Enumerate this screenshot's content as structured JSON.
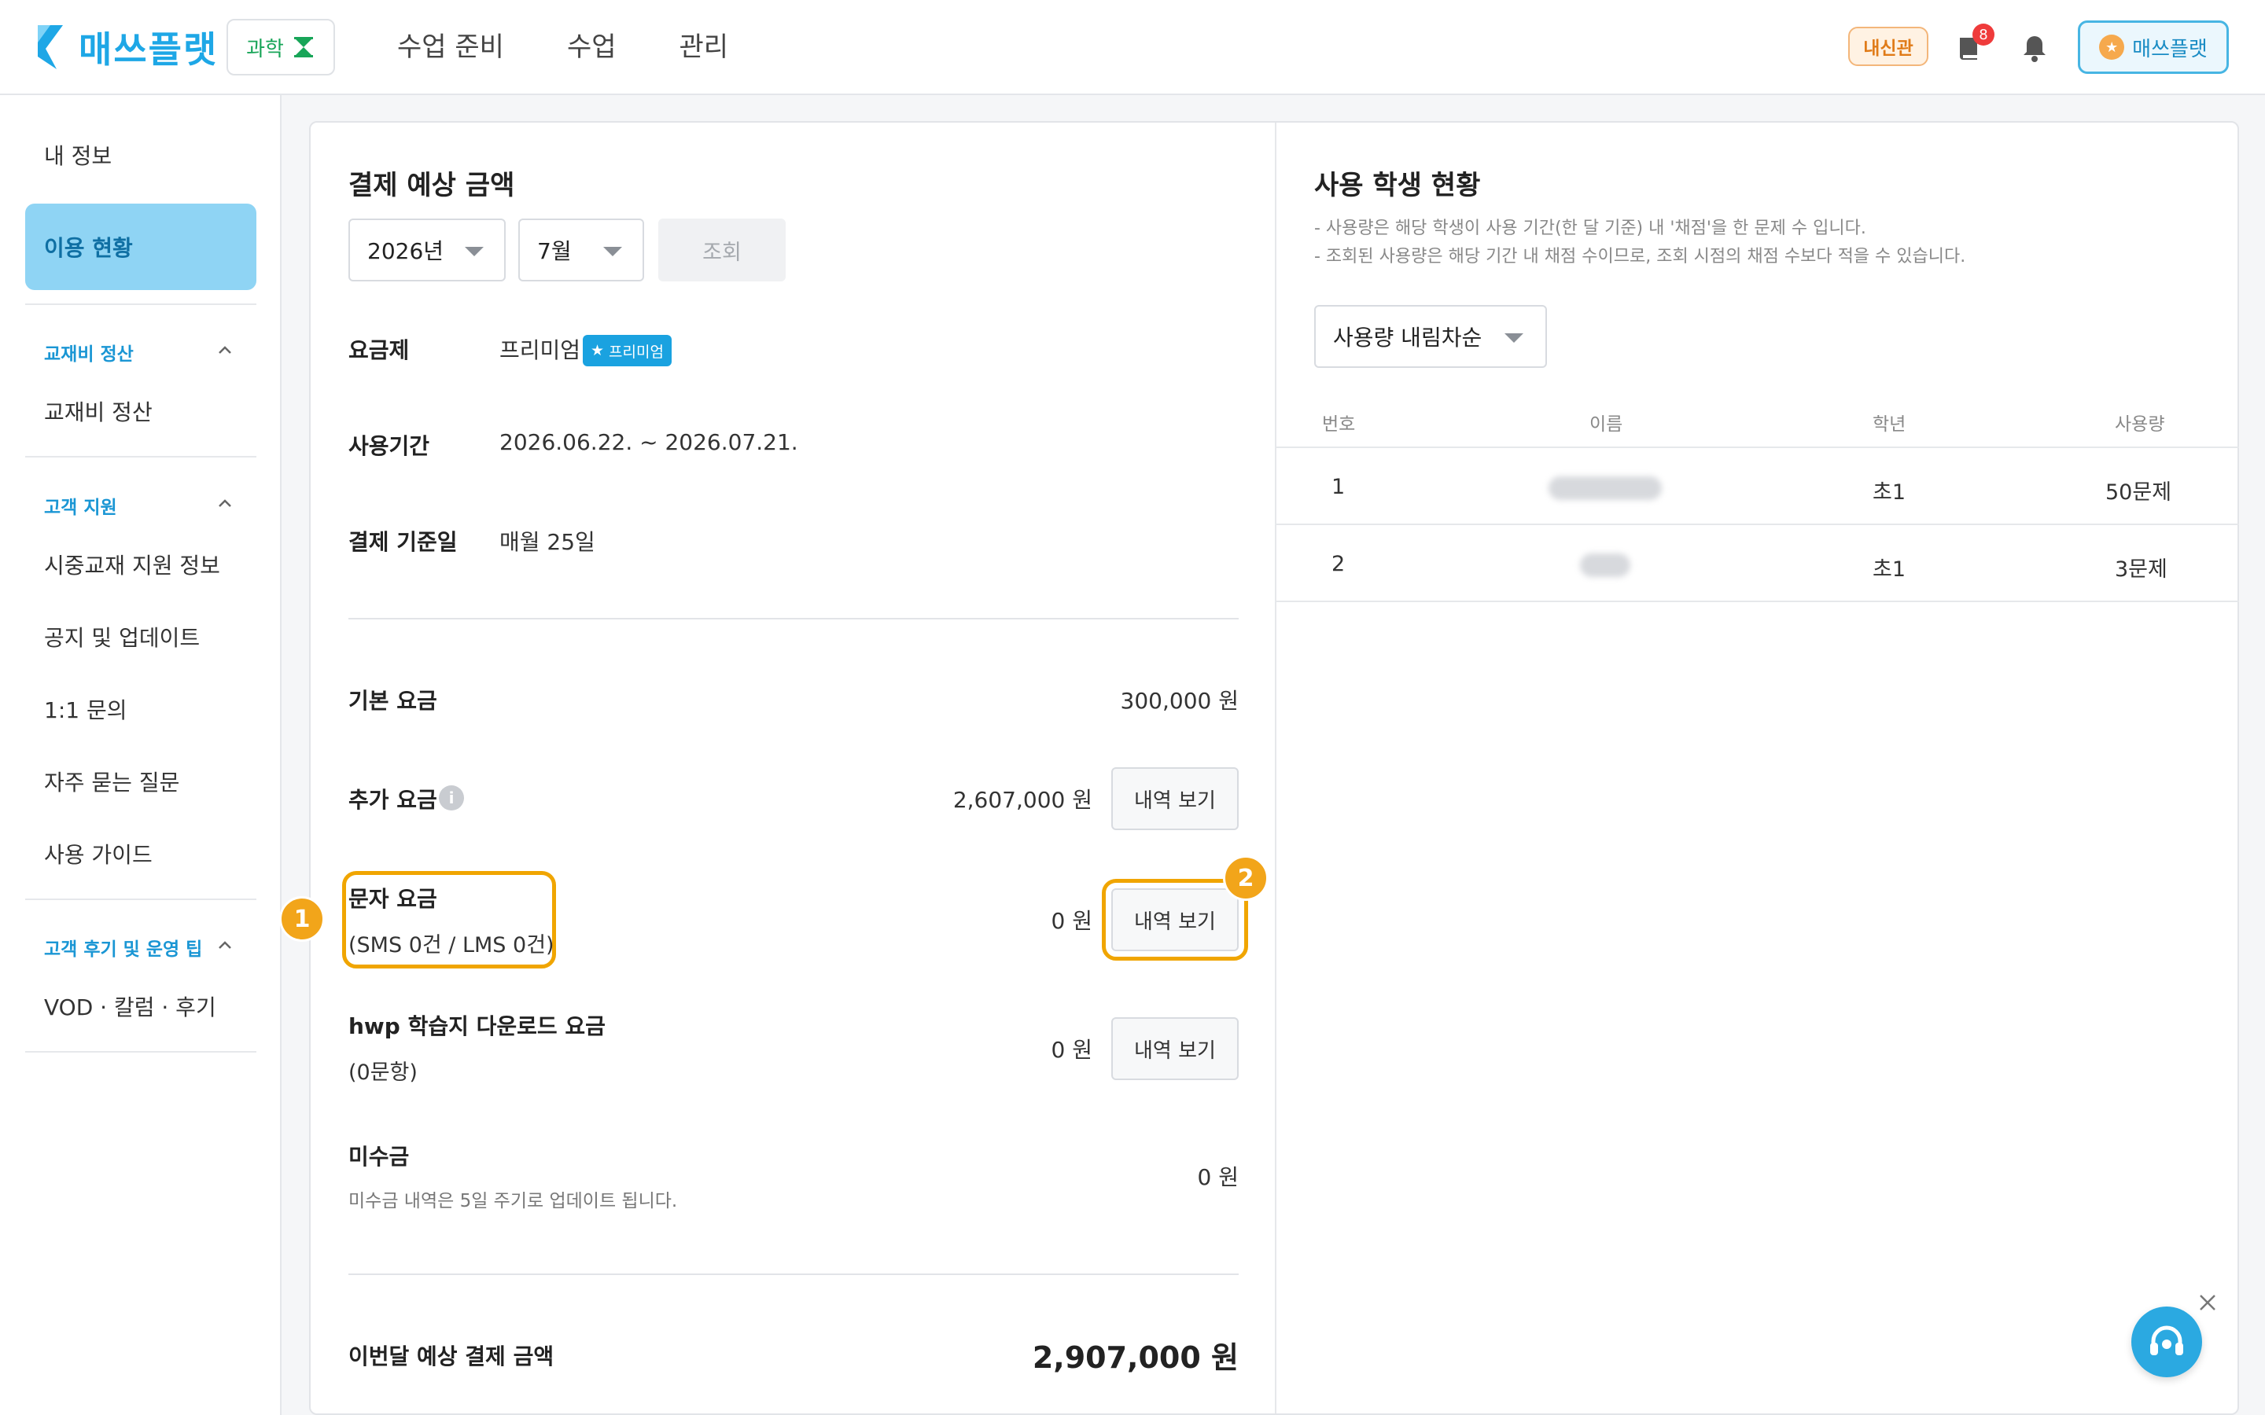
{
  "header": {
    "logo_text": "매쓰플랫",
    "subject_label": "과학",
    "nav": [
      "수업 준비",
      "수업",
      "관리"
    ],
    "badge_label": "내신관",
    "book_count": "8",
    "profile_label": "매쓰플랫",
    "accent_color": "#1ea7e6"
  },
  "sidebar": {
    "my_info": "내 정보",
    "active_item": "이용 현황",
    "sections": [
      {
        "title": "교재비 정산",
        "items": [
          "교재비 정산"
        ]
      },
      {
        "title": "고객 지원",
        "items": [
          "시중교재 지원 정보",
          "공지 및 업데이트",
          "1:1 문의",
          "자주 묻는 질문",
          "사용 가이드"
        ]
      },
      {
        "title": "고객 후기 및 운영 팁",
        "items": [
          "VOD · 칼럼 · 후기"
        ]
      }
    ]
  },
  "payment": {
    "title": "결제 예상 금액",
    "year": "2026년",
    "month": "7월",
    "query_label": "조회",
    "plan_label": "요금제",
    "plan_value": "프리미엄",
    "plan_tag": "프리미엄",
    "period_label": "사용기간",
    "period_value": "2026.06.22. ~ 2026.07.21.",
    "billing_label": "결제 기준일",
    "billing_value": "매월 25일",
    "base_fee_label": "기본 요금",
    "base_fee_amount": "300,000 원",
    "extra_fee_label": "추가 요금",
    "extra_fee_amount": "2,607,000 원",
    "sms_fee_label": "문자 요금",
    "sms_fee_sub": "(SMS 0건 / LMS 0건)",
    "sms_fee_amount": "0 원",
    "hwp_fee_label": "hwp 학습지 다운로드 요금",
    "hwp_fee_sub": "(0문항)",
    "hwp_fee_amount": "0 원",
    "unpaid_label": "미수금",
    "unpaid_note": "미수금 내역은 5일 주기로 업데이트 됩니다.",
    "unpaid_amount": "0 원",
    "detail_button": "내역 보기",
    "total_label": "이번달 예상 결제 금액",
    "total_amount": "2,907,000 원",
    "callouts": [
      "1",
      "2"
    ]
  },
  "usage": {
    "title": "사용 학생 현황",
    "notes": [
      "- 사용량은 해당 학생이 사용 기간(한 달 기준) 내 '채점'을 한 문제 수 입니다.",
      "- 조회된 사용량은 해당 기간 내 채점 수이므로, 조회 시점의 채점 수보다 적을 수 있습니다."
    ],
    "sort_label": "사용량 내림차순",
    "columns": [
      "번호",
      "이름",
      "학년",
      "사용량"
    ],
    "rows": [
      {
        "no": "1",
        "grade": "초1",
        "usage": "50문제"
      },
      {
        "no": "2",
        "grade": "초1",
        "usage": "3문제"
      }
    ]
  }
}
